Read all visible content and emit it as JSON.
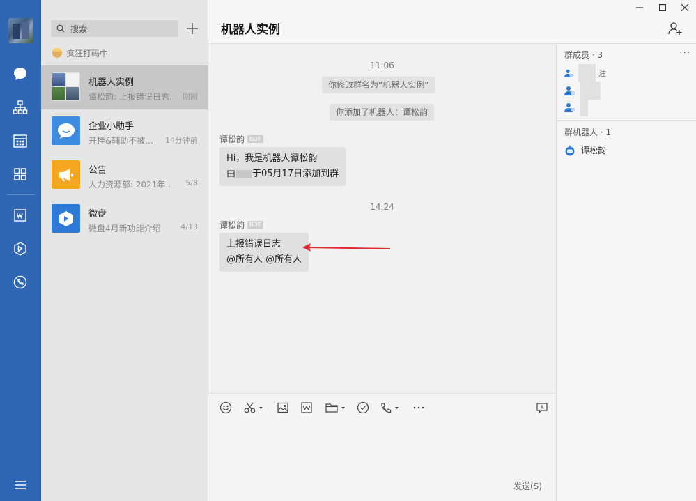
{
  "sidebar": {
    "nav": [
      "chat-icon",
      "org-chart-icon",
      "calendar-icon",
      "apps-grid-icon",
      "document-icon",
      "wedrive-icon",
      "phone-icon",
      "menu-icon"
    ]
  },
  "list": {
    "search_placeholder": "搜索",
    "status_text": "疯狂打码中",
    "conversations": [
      {
        "title": "机器人实例",
        "subtitle": "谭松韵: 上报错误日志...",
        "time": "刚刚"
      },
      {
        "title": "企业小助手",
        "subtitle": "开挂&辅助不被...",
        "time": "14分钟前"
      },
      {
        "title": "公告",
        "subtitle": "人力资源部: 2021年...",
        "time": "5/8"
      },
      {
        "title": "微盘",
        "subtitle": "微盘4月新功能介绍",
        "time": "4/13"
      }
    ]
  },
  "chat": {
    "title": "机器人实例",
    "time1": "11:06",
    "sys1": "你修改群名为“机器人实例”",
    "sys2": "你添加了机器人：谭松韵",
    "msg1": {
      "sender": "谭松韵",
      "badge": "BOT",
      "line1": "Hi，我是机器人谭松韵",
      "line2_prefix": "由",
      "line2_suffix": "于05月17日添加到群"
    },
    "time2": "14:24",
    "msg2": {
      "sender": "谭松韵",
      "badge": "BOT",
      "line1": "上报错误日志",
      "line2": "@所有人  @所有人"
    },
    "send_label": "发送(S)"
  },
  "panel": {
    "members_header": "群成员 · 3",
    "members_more": "···",
    "member_partial": "注",
    "bots_header": "群机器人 · 1",
    "bot_name": "谭松韵"
  },
  "colors": {
    "nav_bg": "#2f67b5",
    "accent_red": "#e0262d",
    "icon_blue": "#2d7ad6"
  }
}
